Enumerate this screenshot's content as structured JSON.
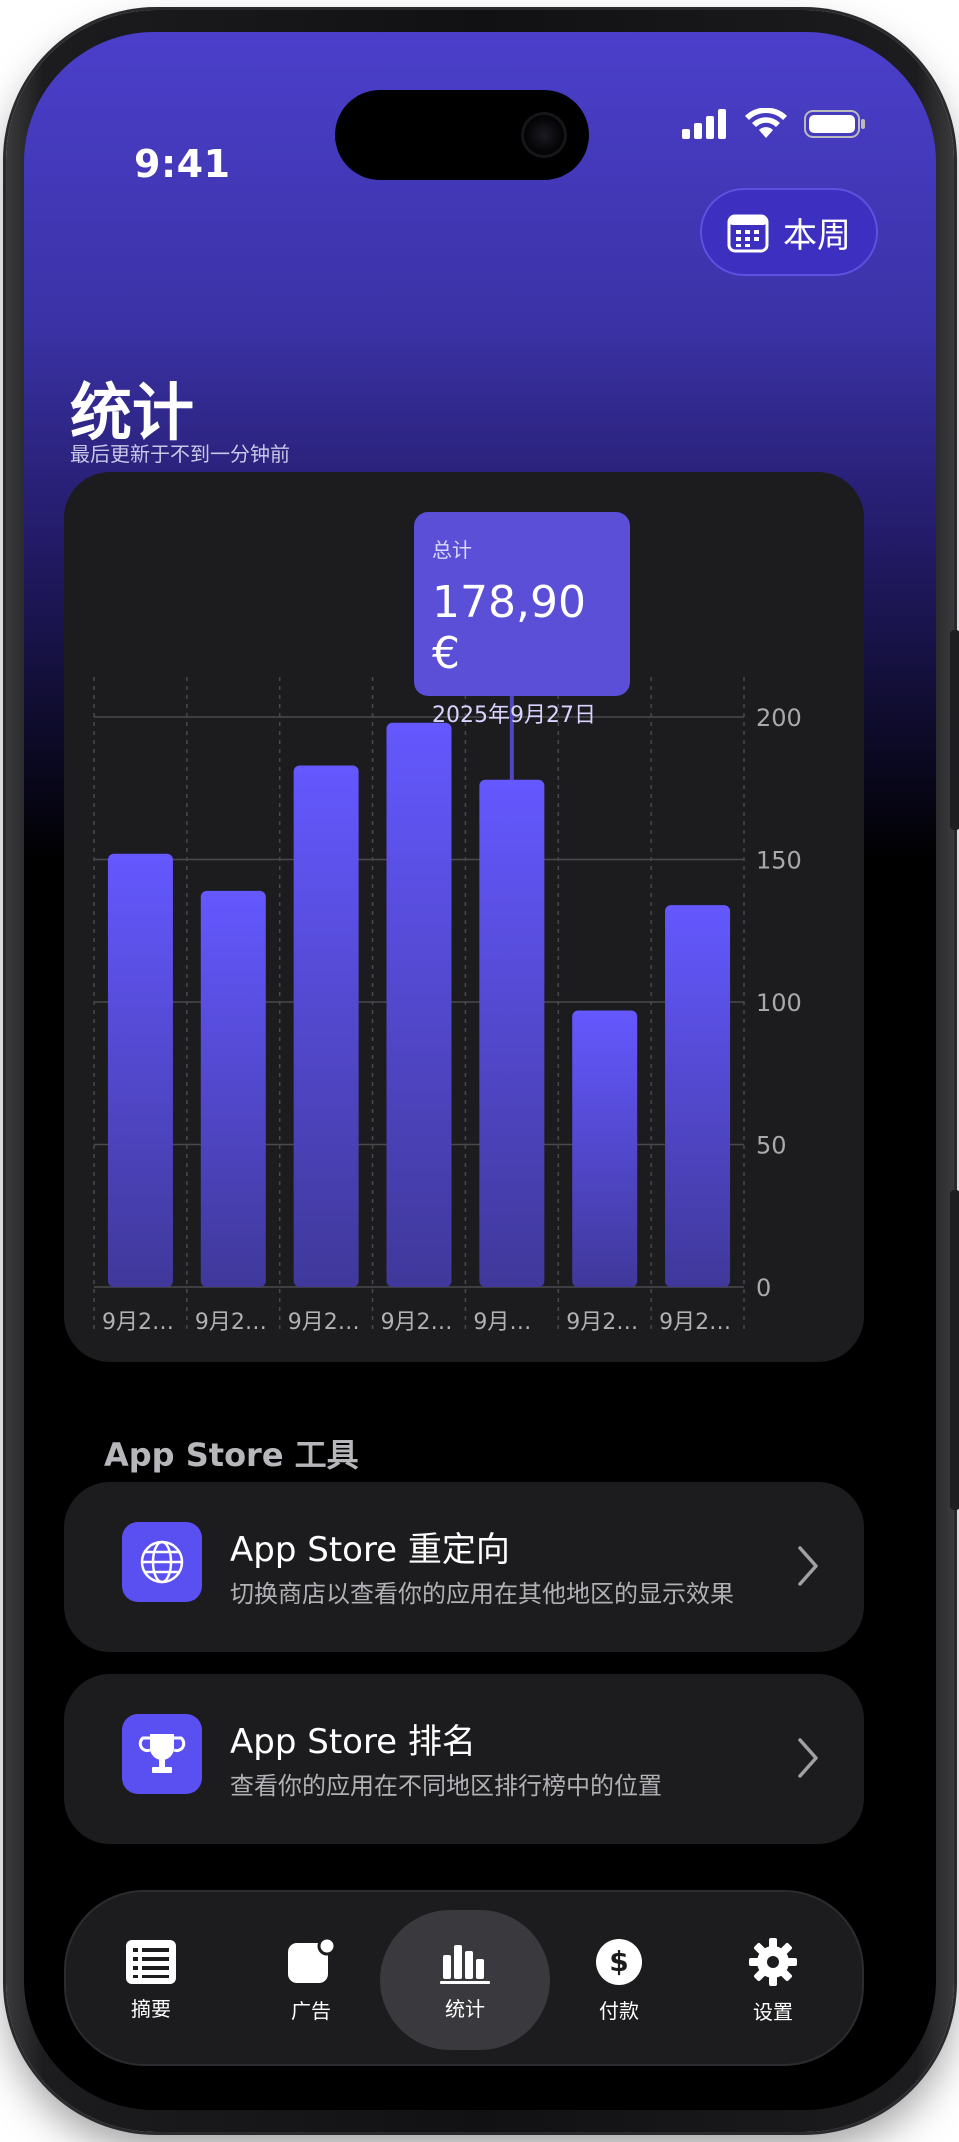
{
  "status_bar": {
    "time": "9:41"
  },
  "header": {
    "week_button_label": "本周",
    "title": "统计",
    "subtitle": "最后更新于不到一分钟前"
  },
  "tooltip": {
    "label": "总计",
    "value": "178,90 €",
    "date": "2025年9月27日"
  },
  "chart_data": {
    "type": "bar",
    "categories": [
      "9月2…",
      "9月2…",
      "9月2…",
      "9月2…",
      "9月…",
      "9月2…",
      "9月2…"
    ],
    "values": [
      152,
      139,
      183,
      198,
      178,
      97,
      134
    ],
    "ylim": [
      0,
      200
    ],
    "yticks": [
      0,
      50,
      100,
      150,
      200
    ],
    "highlight_index": 4,
    "grid": true,
    "axis_side": "right",
    "bar_color_top": "#6458ff",
    "bar_color_bottom": "#40389a"
  },
  "tools": {
    "section_title": "App Store 工具",
    "items": [
      {
        "title": "App Store 重定向",
        "desc": "切换商店以查看你的应用在其他地区的显示效果",
        "icon": "globe-icon"
      },
      {
        "title": "App Store 排名",
        "desc": "查看你的应用在不同地区排行榜中的位置",
        "icon": "trophy-icon"
      }
    ]
  },
  "tabbar": {
    "items": [
      {
        "label": "摘要",
        "icon": "list-icon"
      },
      {
        "label": "广告",
        "icon": "ads-icon"
      },
      {
        "label": "统计",
        "icon": "chart-icon",
        "active": true
      },
      {
        "label": "付款",
        "icon": "dollar-icon"
      },
      {
        "label": "设置",
        "icon": "gear-icon"
      }
    ]
  },
  "colors": {
    "accent": "#5a4ff0",
    "card": "#1c1c1e",
    "header_gradient_top": "#4b3fcb"
  }
}
